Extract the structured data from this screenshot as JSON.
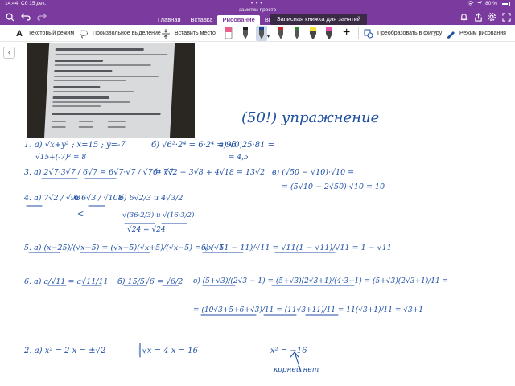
{
  "status_bar": {
    "time": "14:44",
    "date": "Сб 15 дек.",
    "dots": "• • •",
    "battery": "80 %"
  },
  "app": {
    "title": "заметки просто"
  },
  "tabs": [
    {
      "label": "Главная"
    },
    {
      "label": "Вставка"
    },
    {
      "label": "Рисование"
    },
    {
      "label": "Вид"
    }
  ],
  "active_tab": "Рисование",
  "tooltip": "Записная книжка для занятий",
  "ribbon": {
    "text_mode": "Текстовый режим",
    "lasso": "Произвольное выделение",
    "insert_space": "Вставить место",
    "convert_to_shape": "Преобразовать в фигуру",
    "draw_mode": "Режим рисования"
  },
  "pens": [
    {
      "icon": "eraser-icon",
      "color": "#e8608a"
    },
    {
      "icon": "pen-icon",
      "color": "#222222"
    },
    {
      "icon": "pen-icon",
      "color": "#1c3f8f"
    },
    {
      "icon": "pen-icon",
      "color": "#c62828"
    },
    {
      "icon": "pen-icon",
      "color": "#2e7d32"
    },
    {
      "icon": "highlighter-icon",
      "color": "#f5e13a"
    },
    {
      "icon": "highlighter-icon",
      "color": "#e94fae"
    }
  ],
  "colors": {
    "chrome": "#7b3a9e",
    "ink": "#1c4ea3"
  },
  "notes": {
    "heading": "(50!) упражнение",
    "l1a": "1. а) √x+y² ; x=15 ; y=-7",
    "l1b": "√15+(-7)² = 8",
    "l1c": "б) √6²·2⁴ = 6·2⁴ = 96",
    "l1d": "в) √0,25·81 =",
    "l1e": "= 4,5",
    "l3a": "3. а) 2√7·3√7 / 6√7 = 6√7·√7 / √7 = √7",
    "l3b": "б) 7√2 − 3√8 + 4√18 = 13√2",
    "l3c": "в) (√50 − √10)·√10 =",
    "l3d": "= (5√10 − 2√50)·√10 = 10",
    "l4a": "4. а) 7√2 / √98",
    "l4b": "и   6√3 / √108",
    "l4c": "б) 6√2/3 и 4√3/2",
    "l4d": "√(36·2/3) и √(16·3/2)",
    "l4e": "√24 = √24",
    "l4f": "<",
    "l5a": "5. а) (x−25)/(√x−5) = (√x−5)(√x+5)/(√x−5) = √x+5",
    "l5b": "б) (√11 − 11)/√11 = √11(1 − √11)/√11 = 1 − √11",
    "l6a": "6. а) a/√11 = a√11/11",
    "l6b": "б) 15/5√6 = √6/2",
    "l6c": "в) (5+√3)/(2√3 − 1) = (5+√3)(2√3+1)/(4·3−1) = (5+√3)(2√3+1)/11 =",
    "l6d": "= (10√3+5+6+√3)/11 = (11√3+11)/11 = 11(√3+1)/11 = √3+1",
    "l7a": "2. а) x² = 2    x = ±√2",
    "l7b": "| √x = 4    x = 16",
    "l7c": "x² = −16",
    "l7d": "корней нет"
  }
}
